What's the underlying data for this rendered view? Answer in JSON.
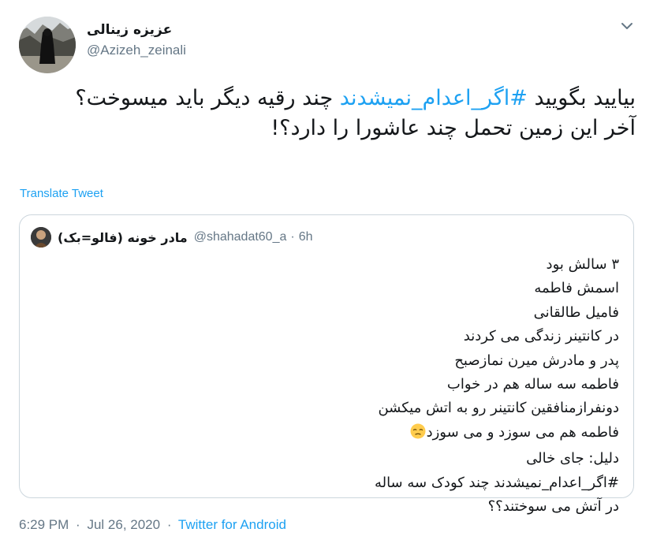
{
  "author": {
    "name": "عزیزه زینالی",
    "handle": "@Azizeh_zeinali"
  },
  "tweet": {
    "text_before": "بیایید بگویید ",
    "hashtag": "#اگر_اعدام_نمیشدند",
    "text_after": " چند رقیه دیگر باید میسوخت؟",
    "line2": "آخر این زمین تحمل چند عاشورا را دارد؟!"
  },
  "translate_label": "Translate Tweet",
  "quoted": {
    "name": "مادر خونه (فالو=بک)",
    "handle": "@shahadat60_a",
    "separator": "·",
    "time": "6h",
    "lines": [
      "۳ سالش بود",
      "اسمش فاطمه",
      "فامیل طالقانی",
      "در کانتینر زندگی می کردند",
      "پدر و مادرش میرن نمازصبح",
      "فاطمه سه ساله هم در خواب",
      "دونفرازمنافقین کانتینر رو به اتش میکشن",
      "فاطمه هم می سوزد و می سوزد",
      "دلیل: جای خالی",
      "#اگر_اعدام_نمیشدند چند کودک سه ساله",
      " در آتش می سوختند؟؟"
    ],
    "emoji": "pensive-face-icon"
  },
  "footer": {
    "time": "6:29 PM",
    "date": "Jul 26, 2020",
    "separator": "·",
    "source": "Twitter for Android"
  }
}
